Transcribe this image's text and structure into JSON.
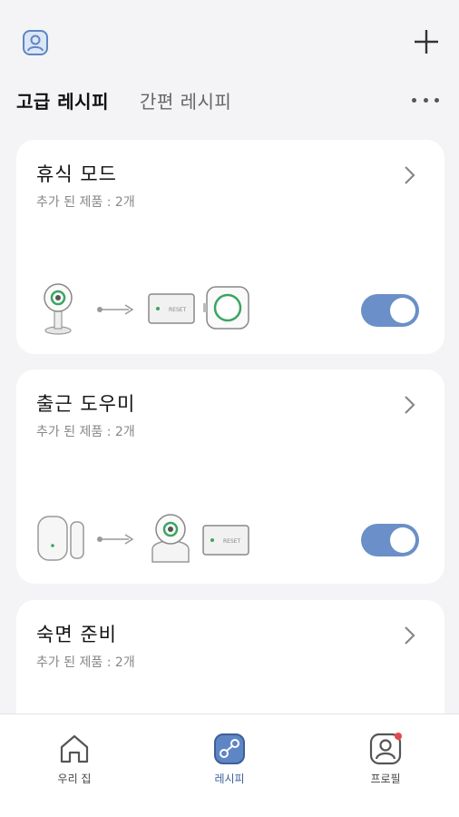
{
  "header": {
    "profile_icon": "user-icon",
    "add_icon": "plus-icon"
  },
  "tabs": [
    {
      "label": "고급 레시피",
      "active": true
    },
    {
      "label": "간편 레시피",
      "active": false
    }
  ],
  "more_icon": "more-dots-icon",
  "cards": [
    {
      "title": "휴식 모드",
      "subtitle": "추가 된 제품 : 2개",
      "enabled": true,
      "devices": [
        "camera-icon",
        "arrow-icon",
        "hub-icon",
        "smart-plug-icon"
      ]
    },
    {
      "title": "출근 도우미",
      "subtitle": "추가 된 제품 : 2개",
      "enabled": true,
      "devices": [
        "door-sensor-icon",
        "arrow-icon",
        "pan-tilt-camera-icon",
        "hub-icon"
      ]
    },
    {
      "title": "숙면 준비",
      "subtitle": "추가 된 제품 : 2개",
      "enabled": true,
      "devices": []
    }
  ],
  "hub_label": "RESET",
  "bottom_nav": [
    {
      "label": "우리 집",
      "icon": "home-icon",
      "active": false
    },
    {
      "label": "레시피",
      "icon": "recipe-icon",
      "active": true
    },
    {
      "label": "프로필",
      "icon": "profile-icon",
      "active": false,
      "badge": true
    }
  ],
  "colors": {
    "accent": "#6b8fc8",
    "active_nav": "#3c5f99",
    "badge": "#e5484d",
    "device_green": "#3aa562"
  }
}
